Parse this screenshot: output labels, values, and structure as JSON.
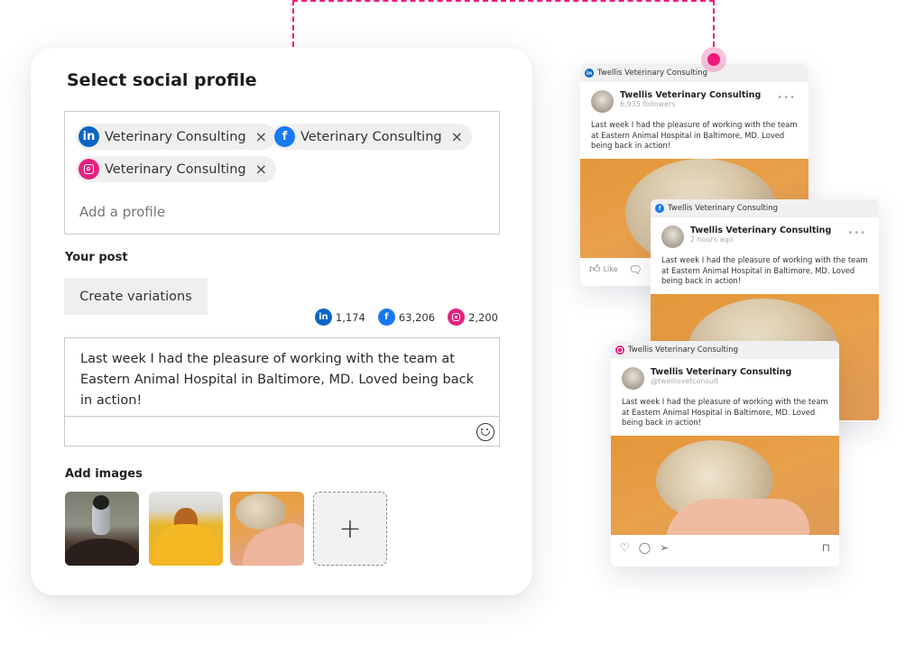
{
  "composer": {
    "title": "Select social profile",
    "selected_profiles": [
      {
        "network": "linkedin",
        "icon": "linkedin-icon",
        "label": "Veterinary Consulting",
        "remove": "×"
      },
      {
        "network": "facebook",
        "icon": "facebook-icon",
        "label": "Veterinary Consulting",
        "remove": "×"
      },
      {
        "network": "instagram",
        "icon": "instagram-icon",
        "label": "Veterinary Consulting",
        "remove": "×"
      }
    ],
    "add_profile_placeholder": "Add a profile",
    "your_post_label": "Your post",
    "create_variations_label": "Create variations",
    "character_counts": [
      {
        "network": "linkedin",
        "value": "1,174"
      },
      {
        "network": "facebook",
        "value": "63,206"
      },
      {
        "network": "instagram",
        "value": "2,200"
      }
    ],
    "post_text": "Last week I had the pleasure of working with the team at Eastern Animal Hospital in Baltimore, MD. Loved being back in action!",
    "emoji_icon": "smiley-icon",
    "add_images_label": "Add images",
    "images": [
      {
        "name": "penguin-on-head-photo"
      },
      {
        "name": "dachshund-in-blanket-photo"
      },
      {
        "name": "hedgehog-in-hand-photo"
      }
    ],
    "add_image_glyph": "+"
  },
  "icons": {
    "linkedin": "in",
    "facebook": "f"
  },
  "colors": {
    "accent": "#f0197d",
    "linkedin": "#0a66c2",
    "facebook": "#1877f2",
    "instagram": "#e6217f"
  },
  "previews": {
    "linkedin": {
      "bar_label": "Twellis Veterinary Consulting",
      "name": "Twellis Veterinary Consulting",
      "sub": "6,935 followers",
      "more": "•••",
      "text": "Last week I had the pleasure of working with the team at Eastern Animal Hospital in Baltimore, MD. Loved being back in action!",
      "actions": [
        "Like",
        "Comment"
      ]
    },
    "facebook": {
      "bar_label": "Twellis Veterinary Consulting",
      "name": "Twellis Veterinary Consulting",
      "sub": "2 hours ago",
      "more": "•••",
      "text": "Last week I had the pleasure of working with the team at Eastern Animal Hospital in Baltimore, MD. Loved being back in action!"
    },
    "instagram": {
      "bar_label": "Twellis Veterinary Consulting",
      "name": "Twellis Veterinary Consulting",
      "sub": "@twellisvetconsult",
      "text": "Last week I had the pleasure of working with the team at Eastern Animal Hospital in Baltimore, MD. Loved being back in action!"
    }
  }
}
